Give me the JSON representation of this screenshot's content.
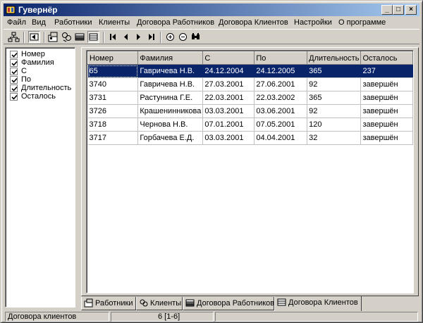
{
  "window": {
    "title": "Гувернёр"
  },
  "title_buttons": {
    "minimize": "_",
    "maximize": "□",
    "close": "×"
  },
  "menu": [
    "Файл",
    "Вид",
    "Работники",
    "Клиенты",
    "Договора Работников",
    "Договора Клиентов",
    "Настройки",
    "О программе"
  ],
  "toolbar": {
    "buttons": [
      "tree-icon",
      "back-icon",
      "workers-icon",
      "clients-icon",
      "worker-contracts-icon",
      "client-contracts-icon",
      "first-record-icon",
      "prev-record-icon",
      "next-record-icon",
      "last-record-icon",
      "add-record-icon",
      "remove-record-icon",
      "search-icon"
    ]
  },
  "columns_panel": {
    "items": [
      {
        "label": "Номер",
        "checked": true
      },
      {
        "label": "Фамилия",
        "checked": true
      },
      {
        "label": "С",
        "checked": true
      },
      {
        "label": "По",
        "checked": true
      },
      {
        "label": "Длительность",
        "checked": true
      },
      {
        "label": "Осталось",
        "checked": true
      }
    ]
  },
  "table": {
    "headers": [
      "Номер",
      "Фамилия",
      "С",
      "По",
      "Длительность",
      "Осталось"
    ],
    "rows": [
      [
        "65",
        "Гавричева Н.В.",
        "24.12.2004",
        "24.12.2005",
        "365",
        "237"
      ],
      [
        "3740",
        "Гавричева Н.В.",
        "27.03.2001",
        "27.06.2001",
        "92",
        "завершён"
      ],
      [
        "3731",
        "Растунина Г.Е.",
        "22.03.2001",
        "22.03.2002",
        "365",
        "завершён"
      ],
      [
        "3726",
        "Крашенинникова",
        "03.03.2001",
        "03.06.2001",
        "92",
        "завершён"
      ],
      [
        "3718",
        "Чернова Н.В.",
        "07.01.2001",
        "07.05.2001",
        "120",
        "завершён"
      ],
      [
        "3717",
        "Горбачева Е.Д.",
        "03.03.2001",
        "04.04.2001",
        "32",
        "завершён"
      ]
    ],
    "selected_row": 0
  },
  "tabs": [
    {
      "label": "Работники",
      "icon": "workers-icon"
    },
    {
      "label": "Клиенты",
      "icon": "clients-icon"
    },
    {
      "label": "Договора Работников",
      "icon": "worker-contracts-icon"
    },
    {
      "label": "Договора Клиентов",
      "icon": "client-contracts-icon",
      "active": true
    }
  ],
  "status": {
    "section": "Договора клиентов",
    "records": "6 [1-6]",
    "extra": ""
  },
  "colors": {
    "title_start": "#0a246a",
    "title_end": "#a6caf0",
    "selection": "#0a246a",
    "face": "#d4d0c8"
  }
}
